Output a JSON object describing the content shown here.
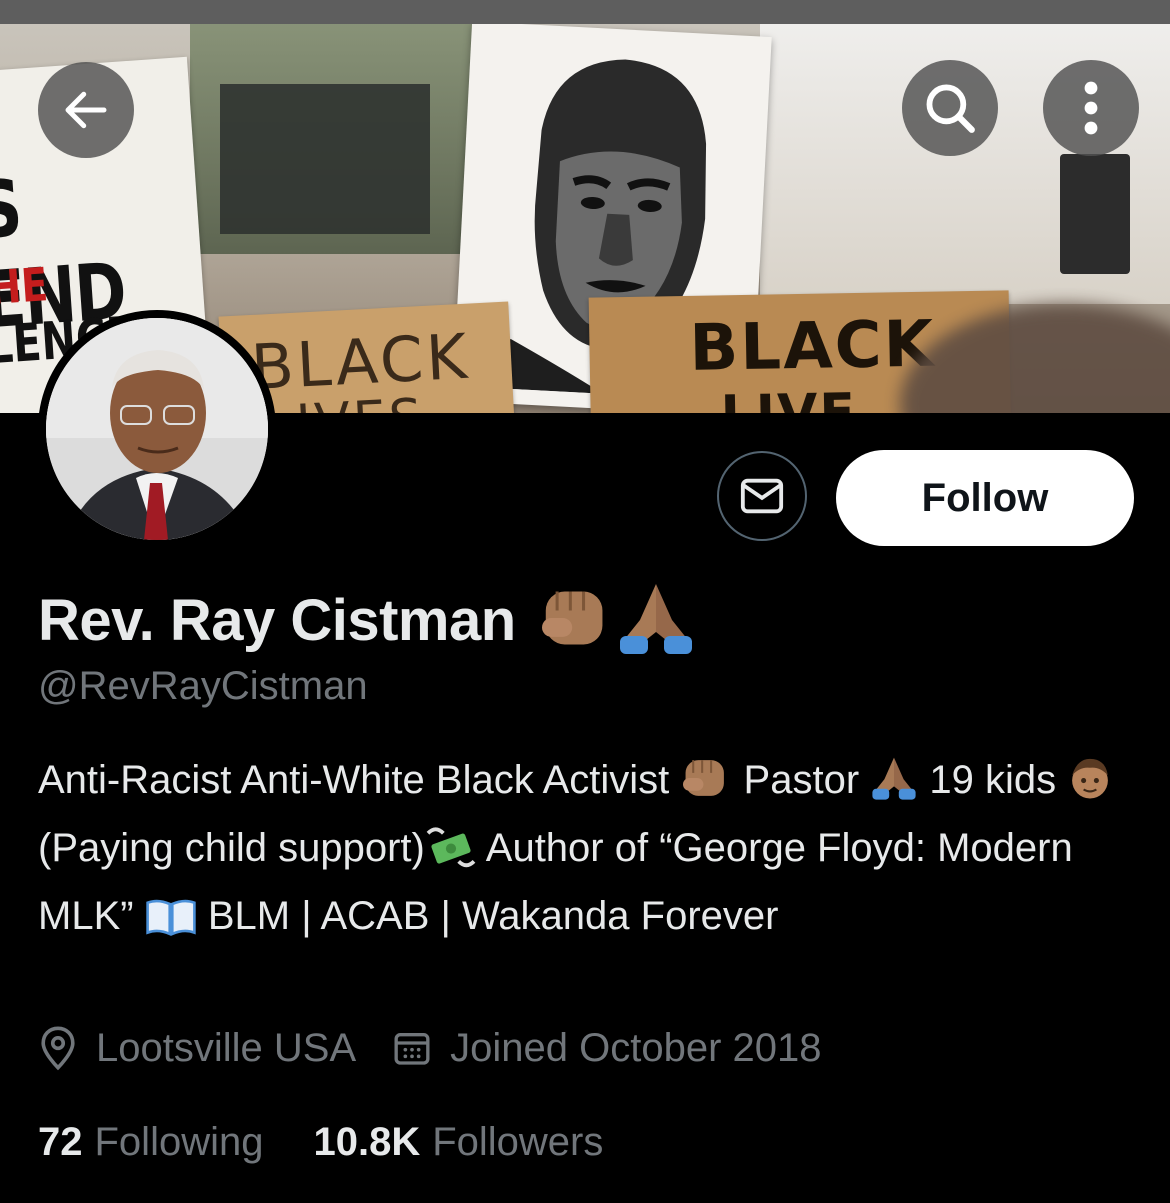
{
  "header": {
    "back_icon": "arrow-left-icon",
    "search_icon": "search-icon",
    "more_icon": "more-vertical-icon"
  },
  "banner": {
    "sign_left_lines": [
      "S END",
      "HE",
      "LENCE"
    ],
    "card1_lines": [
      "BLACK",
      "LIVES"
    ],
    "card2_lines": [
      "BLACK",
      "LIVE"
    ]
  },
  "profile": {
    "name": "Rev. Ray Cistman",
    "name_emojis": [
      "raised-fist-medium-dark",
      "folded-hands"
    ],
    "handle": "@RevRayCistman",
    "follow_label": "Follow",
    "message_icon": "envelope-icon"
  },
  "bio": {
    "p1": "Anti-Racist Anti-White Black Activist",
    "p2": "Pastor",
    "p3": "19 kids",
    "p4": "(Paying child support)",
    "p5": "Author of “George Floyd: Modern MLK”",
    "p6": "BLM | ACAB | Wakanda Forever"
  },
  "meta": {
    "location": "Lootsville USA",
    "location_icon": "location-pin-icon",
    "joined": "Joined October 2018",
    "joined_icon": "calendar-icon"
  },
  "stats": {
    "following_count": "72",
    "following_label": "Following",
    "followers_count": "10.8K",
    "followers_label": "Followers"
  },
  "colors": {
    "background": "#000000",
    "text_primary": "#e7e9ea",
    "text_secondary": "#71767b",
    "follow_bg": "#ffffff",
    "skin_emoji": "#a87a56"
  }
}
